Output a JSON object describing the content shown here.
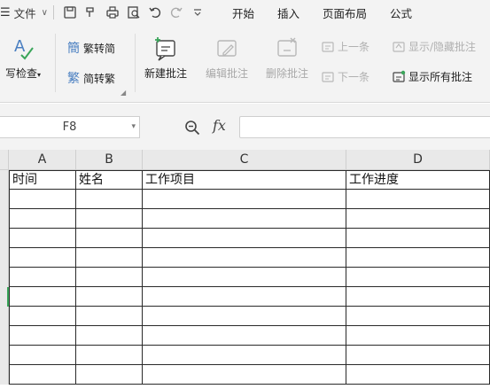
{
  "quick_access": {
    "menu_label": "文件",
    "icons": [
      "hamburger-icon",
      "save-icon",
      "format-painter-icon",
      "print-icon",
      "print-preview-icon",
      "undo-icon",
      "redo-icon",
      "customize-icon"
    ]
  },
  "menu_tabs": [
    "开始",
    "插入",
    "页面布局",
    "公式"
  ],
  "ribbon": {
    "spell_check": "写检查",
    "trad_to_simp": "繁转简",
    "simp_to_trad": "简转繁",
    "new_comment": "新建批注",
    "edit_comment": "编辑批注",
    "delete_comment": "删除批注",
    "prev": "上一条",
    "next": "下一条",
    "show_hide_comment": "显示/隐藏批注",
    "show_all_comments": "显示所有批注"
  },
  "formula_bar": {
    "cell_ref": "F8",
    "fx_label": "fx",
    "formula": ""
  },
  "sheet": {
    "columns": [
      "A",
      "B",
      "C",
      "D"
    ],
    "header_row": [
      "时间",
      "姓名",
      "工作项目",
      "工作进度"
    ],
    "empty_rows": 10
  }
}
